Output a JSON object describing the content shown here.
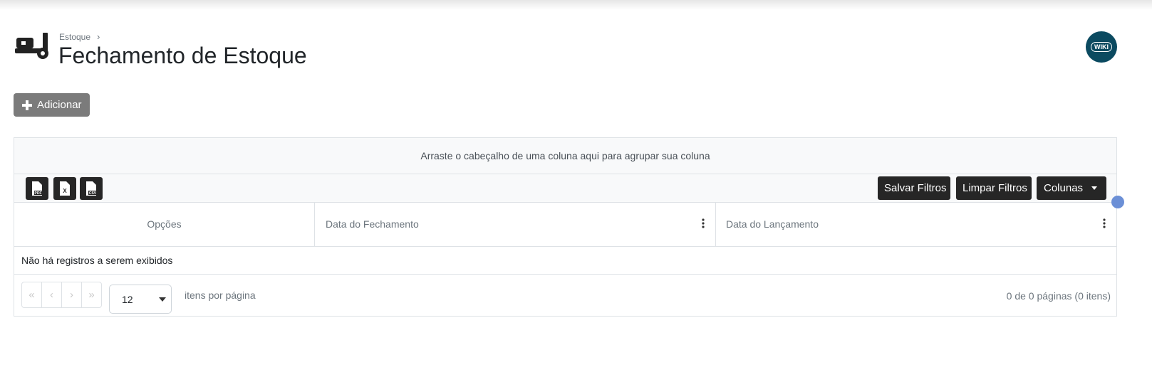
{
  "breadcrumb": {
    "parent": "Estoque",
    "separator": "›"
  },
  "page": {
    "title": "Fechamento de Estoque",
    "icon": "hand-truck-icon"
  },
  "wiki": {
    "label": "WIKI"
  },
  "actions": {
    "add_label": "Adicionar",
    "add_icon": "plus-icon"
  },
  "grid": {
    "group_panel_text": "Arraste o cabeçalho de uma coluna aqui para agrupar sua coluna",
    "export_buttons": [
      {
        "label": "PDF",
        "icon": "pdf-file-icon"
      },
      {
        "label": "X",
        "icon": "excel-file-icon"
      },
      {
        "label": "CSV",
        "icon": "csv-file-icon"
      }
    ],
    "toolbar": {
      "save_filters": "Salvar Filtros",
      "clear_filters": "Limpar Filtros",
      "columns": "Colunas"
    },
    "columns": [
      "Opções",
      "Data do Fechamento",
      "Data do Lançamento"
    ],
    "empty_message": "Não há registros a serem exibidos",
    "pager": {
      "first": "«",
      "prev": "‹",
      "next": "›",
      "last": "»",
      "page_size": "12",
      "per_page_label": "itens por página",
      "info": "0 de 0 páginas (0 itens)"
    }
  },
  "colors": {
    "accent_dark": "#262626",
    "add_button": "#7b7b7b",
    "wiki_bg": "#0b4a60",
    "border": "#dee2e6"
  }
}
